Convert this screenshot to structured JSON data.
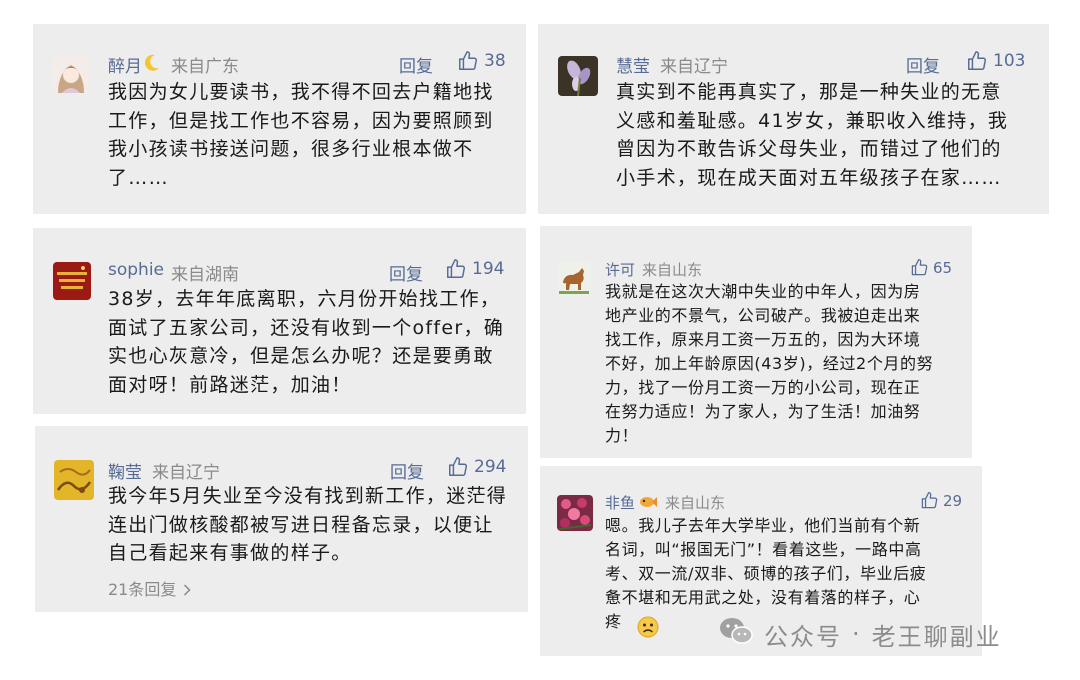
{
  "comments": [
    {
      "user": "醉月",
      "location": "来自广东",
      "reply": "回复",
      "likes": "38",
      "text": "我因为女儿要读书，我不得不回去户籍地找\n工作，但是找工作也不容易，因为要照顾到\n我小孩读书接送问题，很多行业根本做不\n了……"
    },
    {
      "user": "慧莹",
      "location": "来自辽宁",
      "reply": "回复",
      "likes": "103",
      "text": "真实到不能再真实了，那是一种失业的无意\n义感和羞耻感。41岁女，兼职收入维持，我\n曾因为不敢告诉父母失业，而错过了他们的\n小手术，现在成天面对五年级孩子在家……"
    },
    {
      "user": "sophie",
      "location": "来自湖南",
      "reply": "回复",
      "likes": "194",
      "text": "38岁，去年年底离职，六月份开始找工作，\n面试了五家公司，还没有收到一个offer，确\n实也心灰意冷，但是怎么办呢？还是要勇敢\n面对呀！前路迷茫，加油！"
    },
    {
      "user": "许可",
      "location": "来自山东",
      "likes": "65",
      "text": "我就是在这次大潮中失业的中年人，因为房\n地产业的不景气，公司破产。我被迫走出来\n找工作，原来月工资一万五的，因为大环境\n不好，加上年龄原因(43岁)，经过2个月的努\n力，找了一份月工资一万的小公司，现在正\n在努力适应！为了家人，为了生活！加油努\n力！"
    },
    {
      "user": "鞠莹",
      "location": "来自辽宁",
      "reply": "回复",
      "likes": "294",
      "text": "我今年5月失业至今没有找到新工作，迷茫得\n连出门做核酸都被写进日程备忘录，以便让\n自己看起来有事做的样子。",
      "more": "21条回复"
    },
    {
      "user": "非鱼",
      "location": "来自山东",
      "likes": "29",
      "text": "嗯。我儿子去年大学毕业，他们当前有个新\n名词，叫“报国无门”！看着这些，一路中高\n考、双一流/双非、硕博的孩子们，毕业后疲\n惫不堪和无用武之处，没有着落的样子，心\n疼"
    }
  ],
  "watermark": {
    "label": "公众号",
    "separator": "·",
    "name": "老王聊副业"
  },
  "icons": {
    "like": "thumb-up-icon",
    "moon": "crescent-moon-icon",
    "fish": "fish-icon",
    "worried": "worried-face-icon",
    "chevron": "chevron-right-icon",
    "wechat": "wechat-logo-icon"
  },
  "colors": {
    "card_bg": "#ededed",
    "link": "#576b95",
    "meta": "#8a8a8a",
    "text": "#1a1a1a"
  }
}
